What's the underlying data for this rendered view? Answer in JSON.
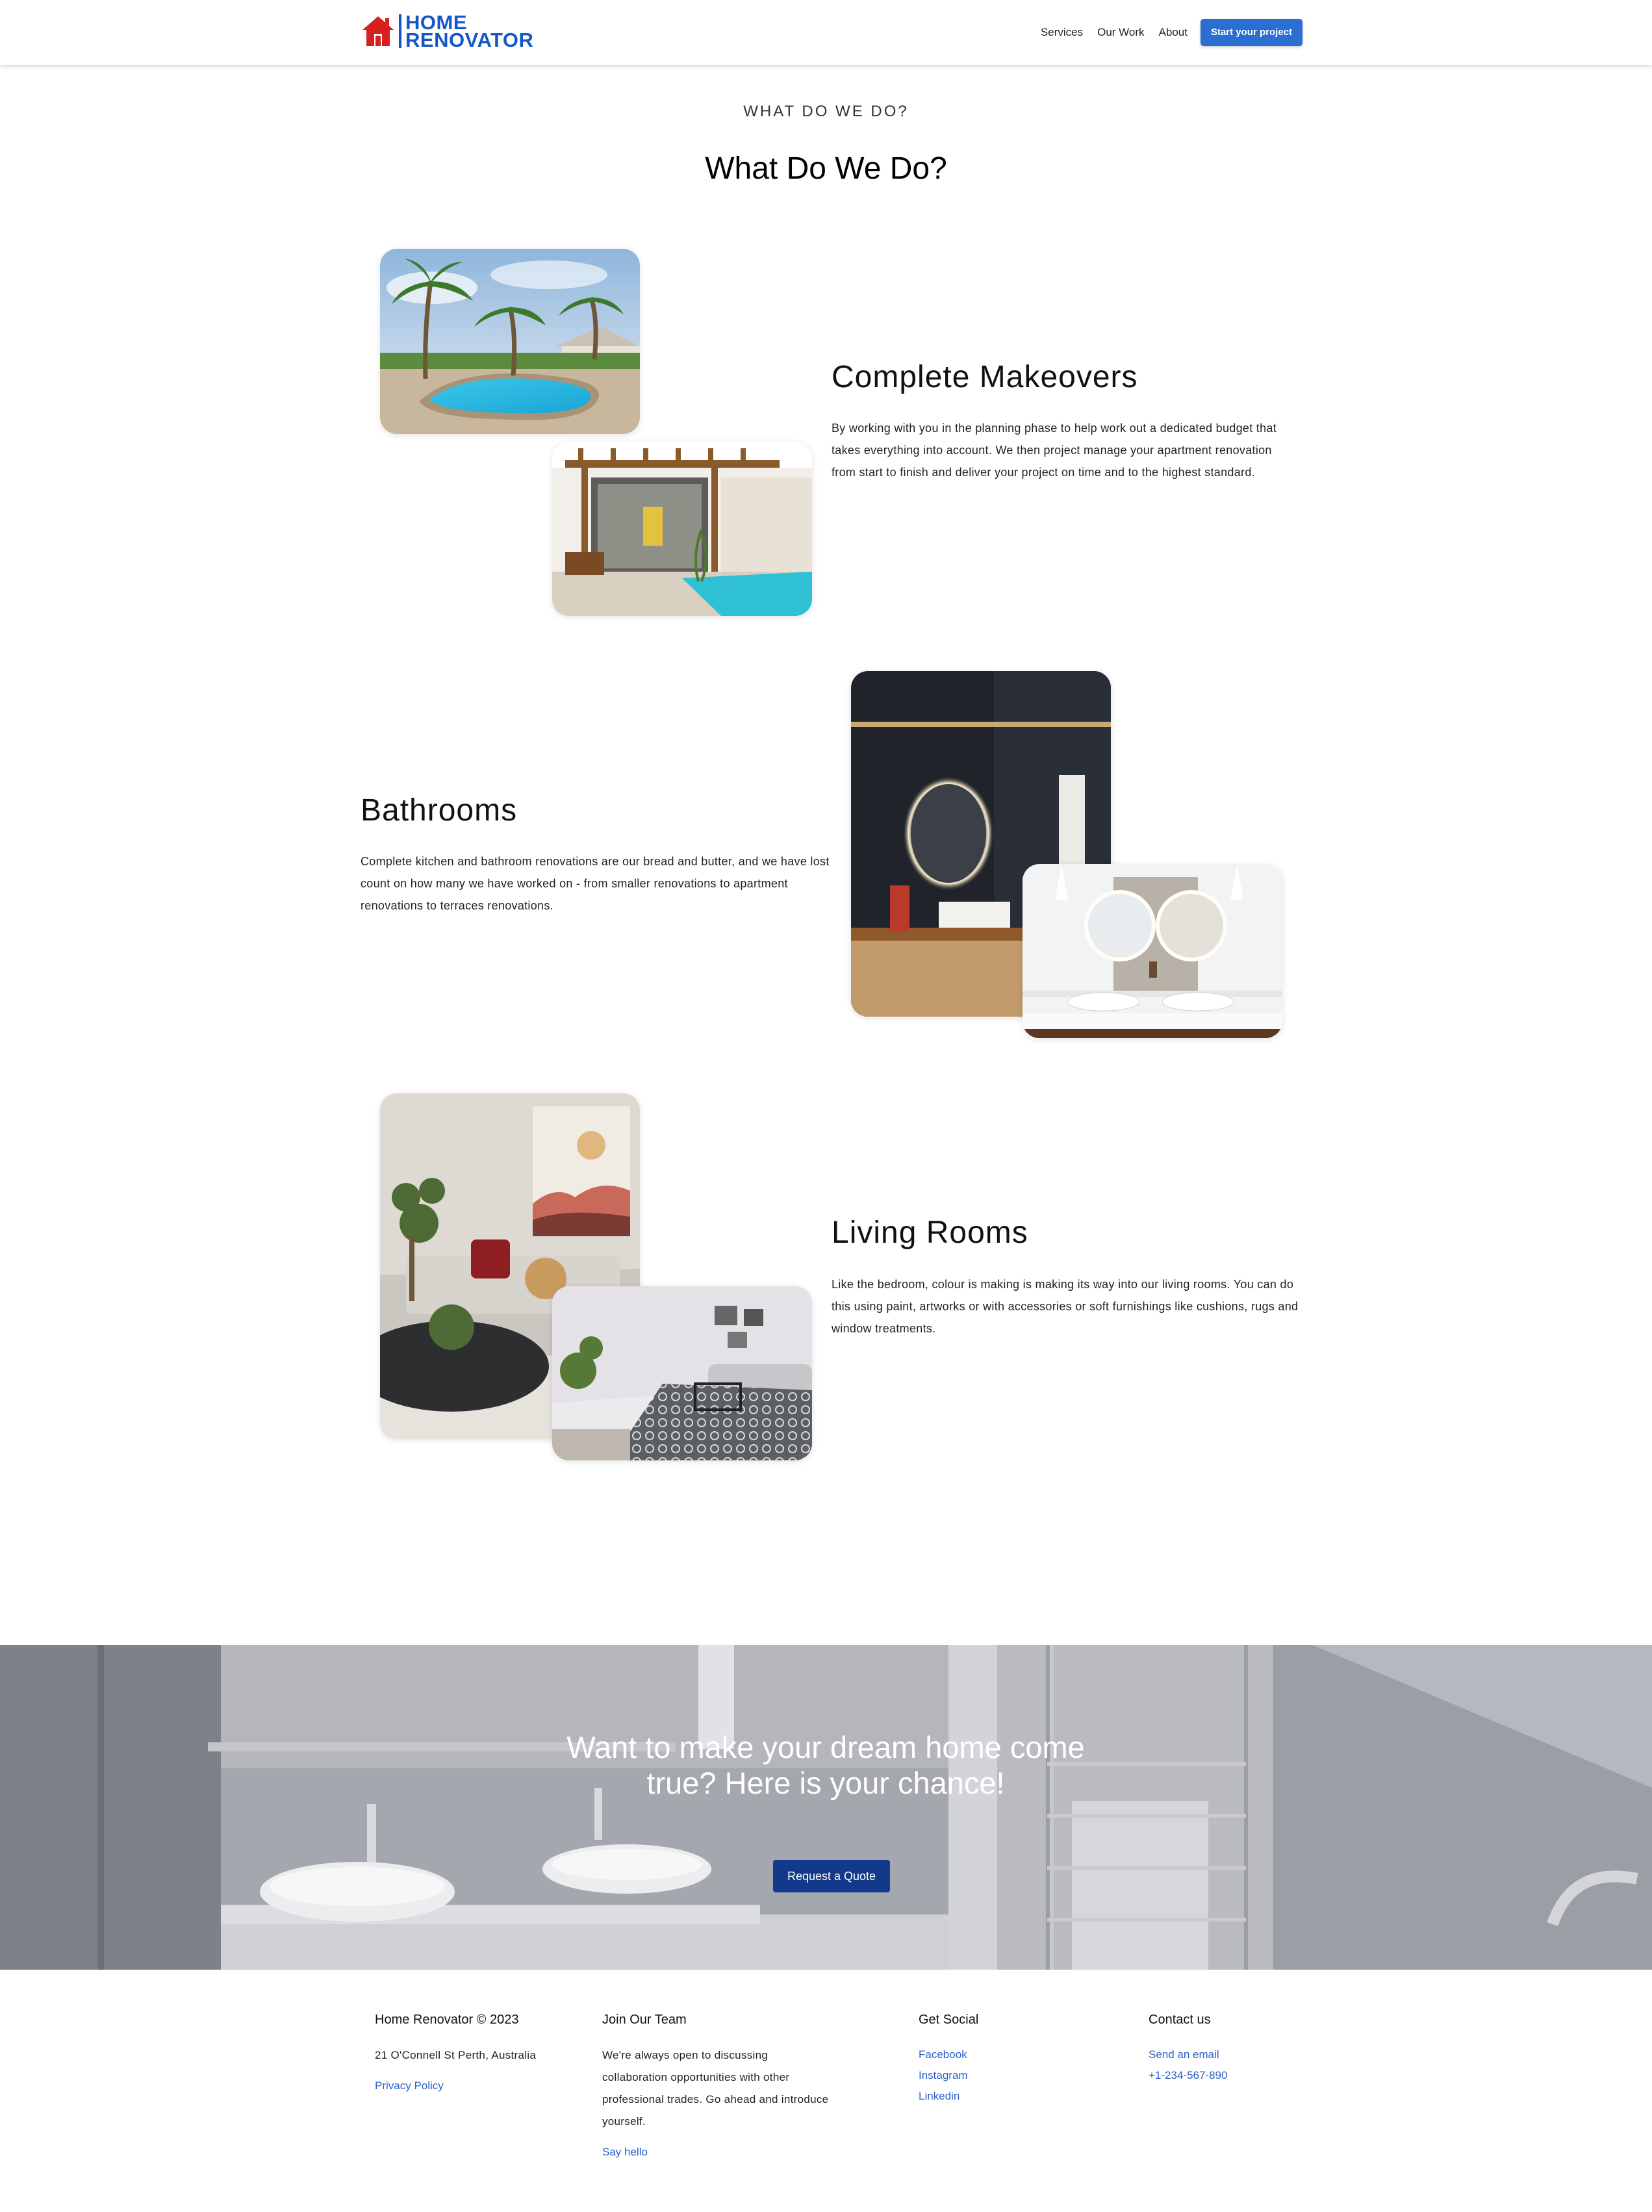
{
  "header": {
    "logo_line1": "HOME",
    "logo_line2": "RENOVATOR",
    "nav": [
      "Services",
      "Our Work",
      "About"
    ],
    "cta": "Start your project"
  },
  "section": {
    "eyebrow": "WHAT DO WE DO?",
    "title": "What Do We Do?"
  },
  "features": [
    {
      "title": "Complete Makeovers",
      "text": "By working with you in the planning phase to help work out a dedicated budget that takes everything into account. We then project manage your apartment renovation from start to finish and deliver your project on time and to the highest standard."
    },
    {
      "title": "Bathrooms",
      "text": "Complete kitchen and bathroom renovations are our bread and butter, and we have lost count on how many we have worked on - from smaller renovations to apartment renovations to terraces renovations."
    },
    {
      "title": "Living Rooms",
      "text": "Like the bedroom, colour is making is making its way into our living rooms. You can do this using paint, artworks or with accessories or soft furnishings like cushions, rugs and window treatments."
    }
  ],
  "cta_banner": {
    "title": "Want to make your dream home come true? Here is your chance!",
    "button": "Request a Quote"
  },
  "footer": {
    "col1": {
      "heading": "Home Renovator © 2023",
      "address": "21 O'Connell St Perth, Australia",
      "link": "Privacy Policy"
    },
    "col2": {
      "heading": "Join Our Team",
      "text": "We're always open to discussing collaboration opportunities with other professional trades. Go ahead and introduce yourself.",
      "link": "Say hello"
    },
    "col3": {
      "heading": "Get Social",
      "links": [
        "Facebook",
        "Instagram",
        "Linkedin"
      ]
    },
    "col4": {
      "heading": "Contact us",
      "links": [
        "Send an email",
        "+1-234-567-890"
      ]
    }
  },
  "colors": {
    "brand": "#1457c8",
    "logo_house": "#d62020",
    "cta_button": "#2a6ed1",
    "banner_button": "#13398a",
    "link": "#2a62c9"
  }
}
